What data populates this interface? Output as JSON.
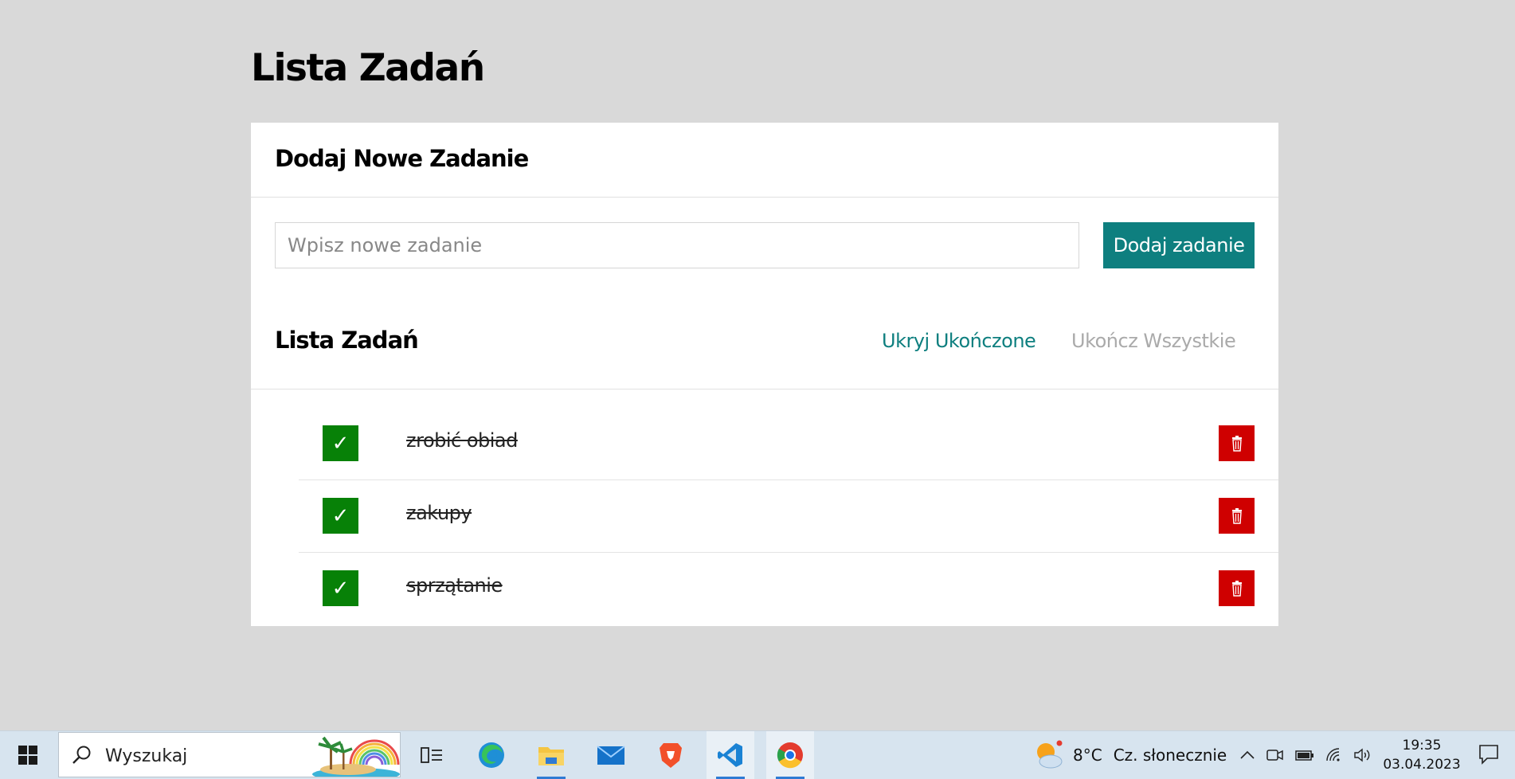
{
  "page": {
    "title": "Lista Zadań"
  },
  "add_section": {
    "heading": "Dodaj Nowe Zadanie",
    "input_placeholder": "Wpisz nowe zadanie",
    "input_value": "",
    "add_button_label": "Dodaj zadanie"
  },
  "list_section": {
    "heading": "Lista Zadań",
    "hide_completed_label": "Ukryj Ukończone",
    "complete_all_label": "Ukończ Wszystkie",
    "tasks": [
      {
        "text": "zrobić obiad",
        "completed": true,
        "check_glyph": "✓"
      },
      {
        "text": "zakupy",
        "completed": true,
        "check_glyph": "✓"
      },
      {
        "text": "sprzątanie",
        "completed": true,
        "check_glyph": "✓"
      }
    ]
  },
  "colors": {
    "accent": "#0e7f7f",
    "complete_green": "#078107",
    "delete_red": "#cf0000",
    "background": "#d9d9d9",
    "muted_link": "#aaaaaa"
  },
  "taskbar": {
    "search_label": "Wyszukaj",
    "apps": [
      "task-view-icon",
      "edge-icon",
      "file-explorer-icon",
      "mail-icon",
      "brave-icon",
      "vscode-icon",
      "chrome-icon"
    ],
    "weather_temp": "8°C",
    "weather_desc": "Cz. słonecznie",
    "time": "19:35",
    "date": "03.04.2023"
  }
}
